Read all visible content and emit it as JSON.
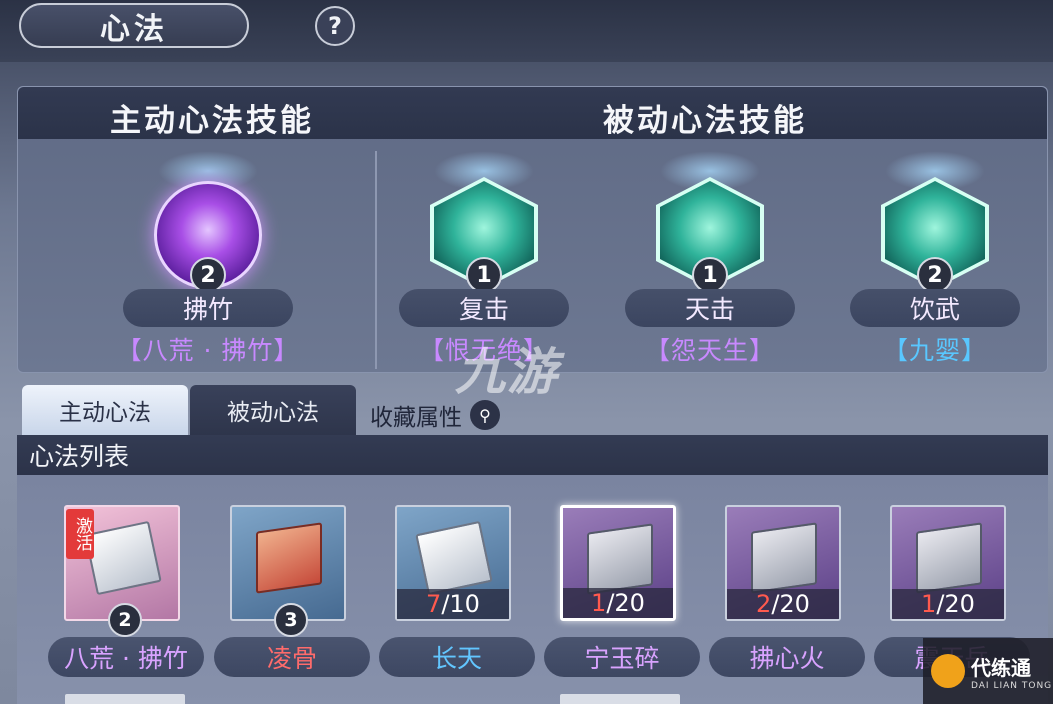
{
  "header": {
    "title": "心法",
    "help": "?"
  },
  "skills": {
    "active_title": "主动心法技能",
    "passive_title": "被动心法技能",
    "active": [
      {
        "name": "拂竹",
        "level": "2",
        "source": "【八荒 · 拂竹】",
        "source_color": "#c889ff",
        "icon": "meditating-figure-icon"
      }
    ],
    "passive": [
      {
        "name": "复击",
        "level": "1",
        "source": "【恨无绝】",
        "source_color": "#c889ff",
        "icon": "fist-swirl-icon"
      },
      {
        "name": "天击",
        "level": "1",
        "source": "【怨天生】",
        "source_color": "#c889ff",
        "icon": "scorpion-icon"
      },
      {
        "name": "饮武",
        "level": "2",
        "source": "【九婴】",
        "source_color": "#59c7ff",
        "icon": "serpent-icon"
      }
    ]
  },
  "tabs": [
    {
      "label": "主动心法",
      "active": true
    },
    {
      "label": "被动心法",
      "active": false
    }
  ],
  "favorite_attr": "收藏属性",
  "list_title": "心法列表",
  "items": [
    {
      "name": "八荒 · 拂竹",
      "name_color": "#d9a3ff",
      "style": "pink",
      "badge": "激活",
      "level": "2",
      "cur": "",
      "total": ""
    },
    {
      "name": "凌骨",
      "name_color": "#ff6b6b",
      "style": "blue",
      "badge": "",
      "level": "3",
      "cur": "",
      "total": ""
    },
    {
      "name": "长天",
      "name_color": "#62c6ff",
      "style": "blue",
      "badge": "",
      "level": "",
      "cur": "7",
      "total": "/10"
    },
    {
      "name": "宁玉碎",
      "name_color": "#d9a3ff",
      "style": "purple",
      "badge": "",
      "level": "",
      "cur": "1",
      "total": "/20",
      "selected": true
    },
    {
      "name": "拂心火",
      "name_color": "#d9a3ff",
      "style": "purple",
      "badge": "",
      "level": "",
      "cur": "2",
      "total": "/20"
    },
    {
      "name": "震天岳",
      "name_color": "#d9a3ff",
      "style": "purple",
      "badge": "",
      "level": "",
      "cur": "1",
      "total": "/20"
    }
  ],
  "watermark": "九游",
  "corner_logo": {
    "title": "代练通",
    "subtitle": "DAI LIAN TONG"
  }
}
